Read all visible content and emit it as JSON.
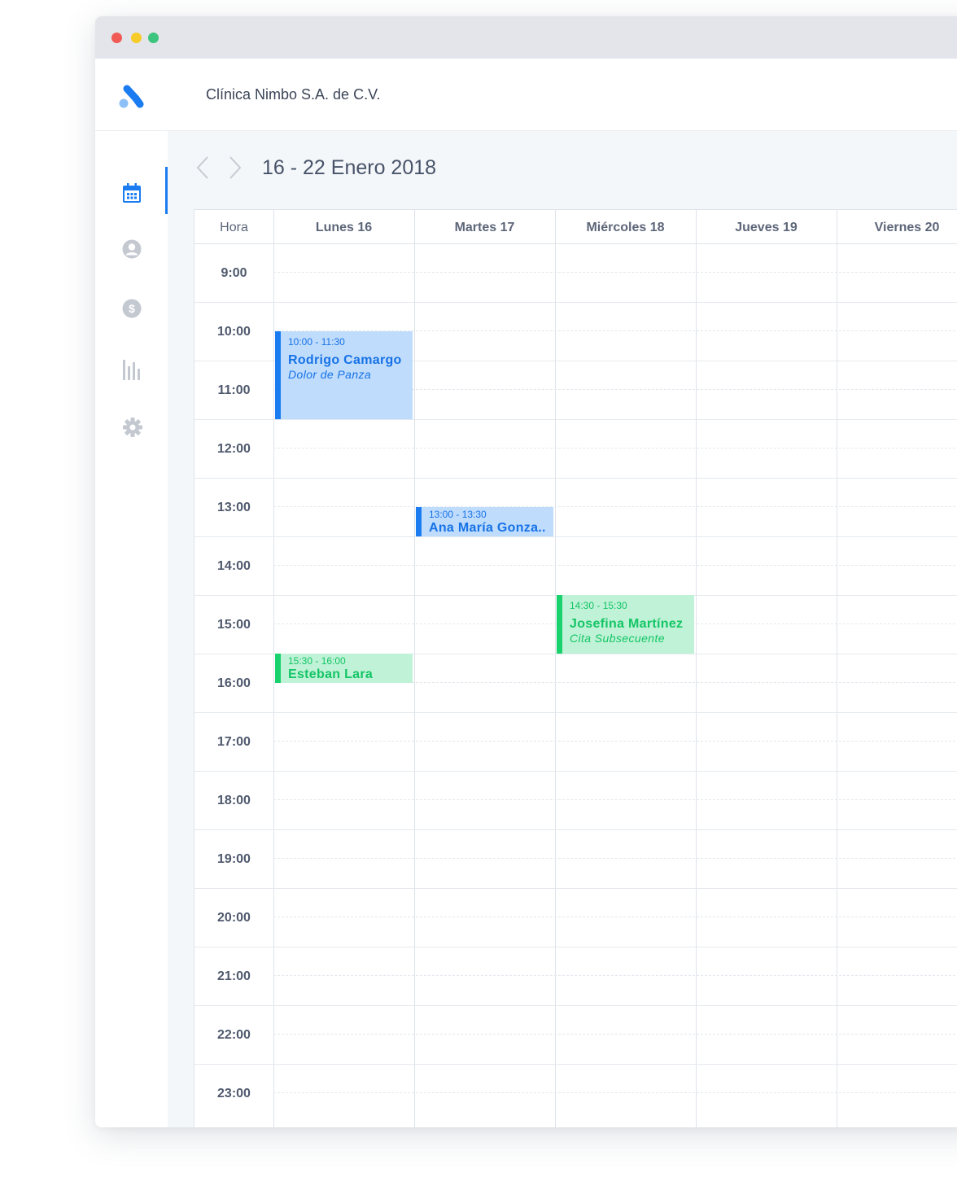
{
  "window": {
    "controls": [
      "close",
      "minimize",
      "maximize"
    ]
  },
  "sidebar": {
    "logo": "app-logo",
    "items": [
      {
        "id": "calendar",
        "icon": "calendar-icon",
        "active": true
      },
      {
        "id": "patients",
        "icon": "user-icon",
        "active": false
      },
      {
        "id": "billing",
        "icon": "dollar-icon",
        "active": false
      },
      {
        "id": "reports",
        "icon": "bar-chart-icon",
        "active": false
      },
      {
        "id": "settings",
        "icon": "gear-icon",
        "active": false
      }
    ],
    "active_color": "#1a7cf0",
    "inactive_color": "#c4c9d1"
  },
  "header": {
    "clinic_name": "Clínica Nimbo S.A. de C.V."
  },
  "toolbar": {
    "prev_icon": "chevron-left-icon",
    "next_icon": "chevron-right-icon",
    "week_range": "16 - 22 Enero 2018"
  },
  "calendar": {
    "hour_header": "Hora",
    "days": [
      "Lunes 16",
      "Martes 17",
      "Miércoles 18",
      "Jueves 19",
      "Viernes 20"
    ],
    "hours": [
      "9:00",
      "10:00",
      "11:00",
      "12:00",
      "13:00",
      "14:00",
      "15:00",
      "16:00",
      "17:00",
      "18:00",
      "19:00",
      "20:00",
      "21:00",
      "22:00",
      "23:00"
    ],
    "events": [
      {
        "day": 0,
        "start": 10.0,
        "end": 11.5,
        "time": "10:00 - 11:30",
        "name": "Rodrigo Camargo",
        "reason": "Dolor de Panza",
        "color": "blue"
      },
      {
        "day": 1,
        "start": 13.0,
        "end": 13.5,
        "time": "13:00 - 13:30",
        "name": "Ana María Gonza..",
        "reason": "",
        "color": "blue"
      },
      {
        "day": 2,
        "start": 14.5,
        "end": 15.5,
        "time": "14:30 - 15:30",
        "name": "Josefina Martínez",
        "reason": "Cita Subsecuente",
        "color": "green"
      },
      {
        "day": 0,
        "start": 15.5,
        "end": 16.0,
        "time": "15:30 - 16:00",
        "name": "Esteban Lara",
        "reason": "",
        "color": "green"
      }
    ]
  },
  "colors": {
    "event_blue": "#1a7cf0",
    "event_blue_bg": "#bfdcfc",
    "event_green": "#19d16d",
    "event_green_bg": "#bff2d6"
  }
}
